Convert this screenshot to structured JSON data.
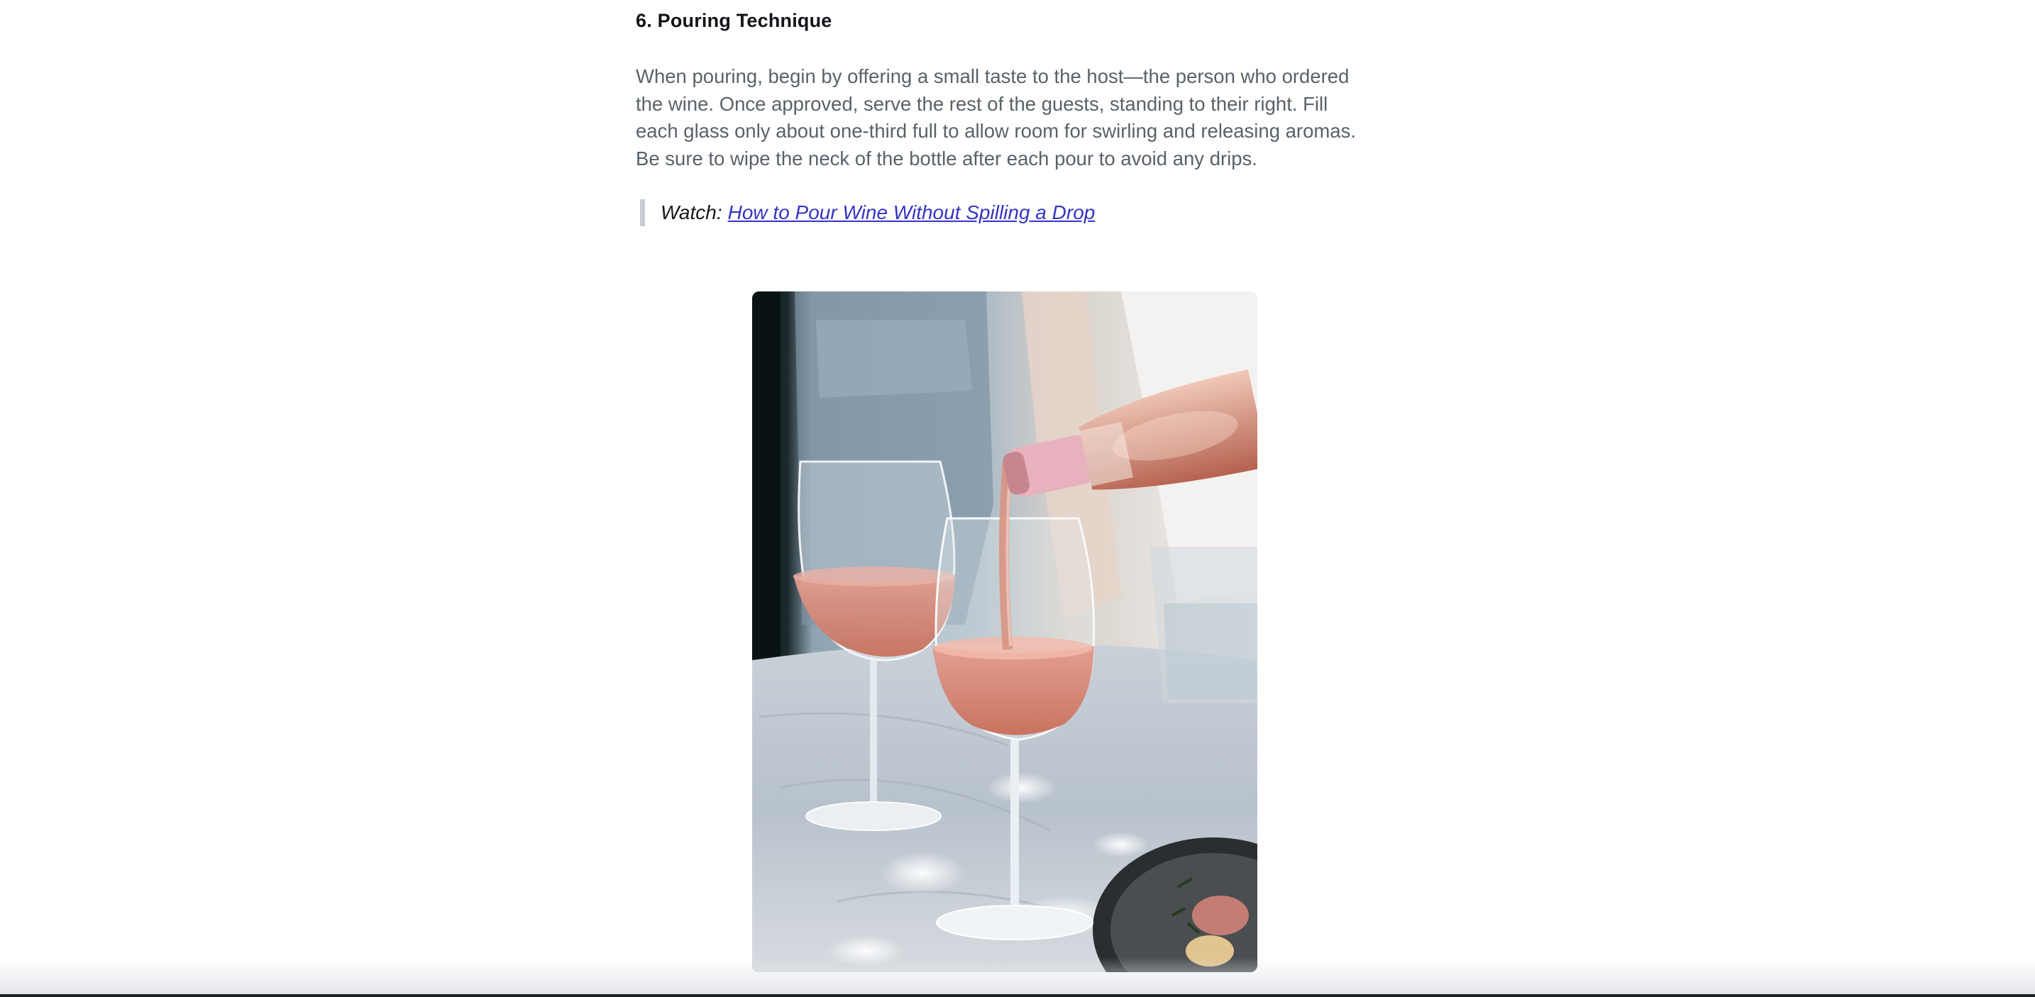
{
  "article": {
    "section_heading": "6. Pouring Technique",
    "paragraph": "When pouring, begin by offering a small taste to the host—the person who ordered the wine. Once approved, serve the rest of the guests, standing to their right. Fill each glass only about one-third full to allow room for swirling and releasing aromas. Be sure to wipe the neck of the bottle after each pour to avoid any drips.",
    "watch": {
      "label": "Watch:",
      "link_text": "How to Pour Wine Without Spilling a Drop"
    },
    "image": {
      "alt": ""
    }
  },
  "colors": {
    "link": "#3434c4",
    "body_text": "#5a6169",
    "heading": "#111418",
    "quote_bar": "#c9ccd1",
    "rose_wine": "#d98a7f"
  }
}
